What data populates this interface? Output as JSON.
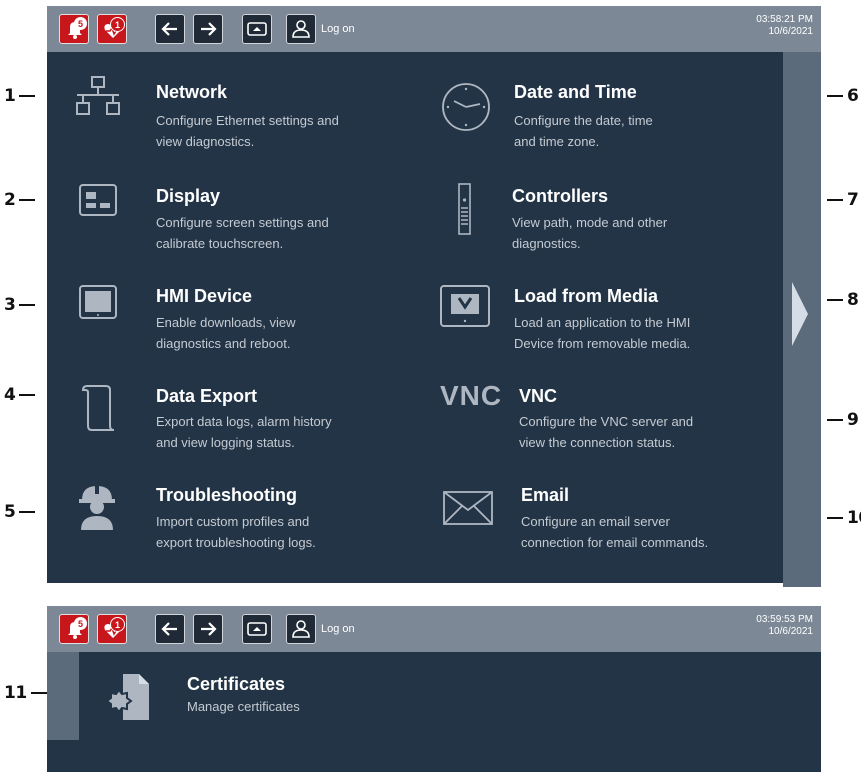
{
  "callouts": [
    "1",
    "2",
    "3",
    "4",
    "5",
    "6",
    "7",
    "8",
    "9",
    "10",
    "11"
  ],
  "screen1": {
    "toolbar": {
      "alarm_count": "5",
      "diag_count": "1",
      "logon_label": "Log on",
      "time": "03:58:21 PM",
      "date": "10/6/2021"
    },
    "items": [
      {
        "title": "Network",
        "desc1": "Configure Ethernet settings and",
        "desc2": "view diagnostics."
      },
      {
        "title": "Display",
        "desc1": "Configure screen settings and",
        "desc2": "calibrate touchscreen."
      },
      {
        "title": "HMI Device",
        "desc1": "Enable downloads, view",
        "desc2": "diagnostics and reboot."
      },
      {
        "title": "Data Export",
        "desc1": "Export data logs, alarm history",
        "desc2": "and view logging status."
      },
      {
        "title": "Troubleshooting",
        "desc1": "Import custom profiles and",
        "desc2": "export troubleshooting logs."
      },
      {
        "title": "Date and Time",
        "desc1": "Configure the date, time",
        "desc2": "and time zone."
      },
      {
        "title": "Controllers",
        "desc1": "View path, mode and other",
        "desc2": "diagnostics."
      },
      {
        "title": "Load from Media",
        "desc1": "Load an application to the HMI",
        "desc2": "Device from removable media."
      },
      {
        "title": "VNC",
        "desc1": "Configure the VNC server and",
        "desc2": "view the connection status."
      },
      {
        "title": "Email",
        "desc1": "Configure an email server",
        "desc2": "connection for email commands."
      }
    ],
    "vnc_logo": "VNC"
  },
  "screen2": {
    "toolbar": {
      "alarm_count": "5",
      "diag_count": "1",
      "logon_label": "Log on",
      "time": "03:59:53 PM",
      "date": "10/6/2021"
    },
    "items": [
      {
        "title": "Certificates",
        "desc1": "Manage certificates"
      }
    ]
  }
}
